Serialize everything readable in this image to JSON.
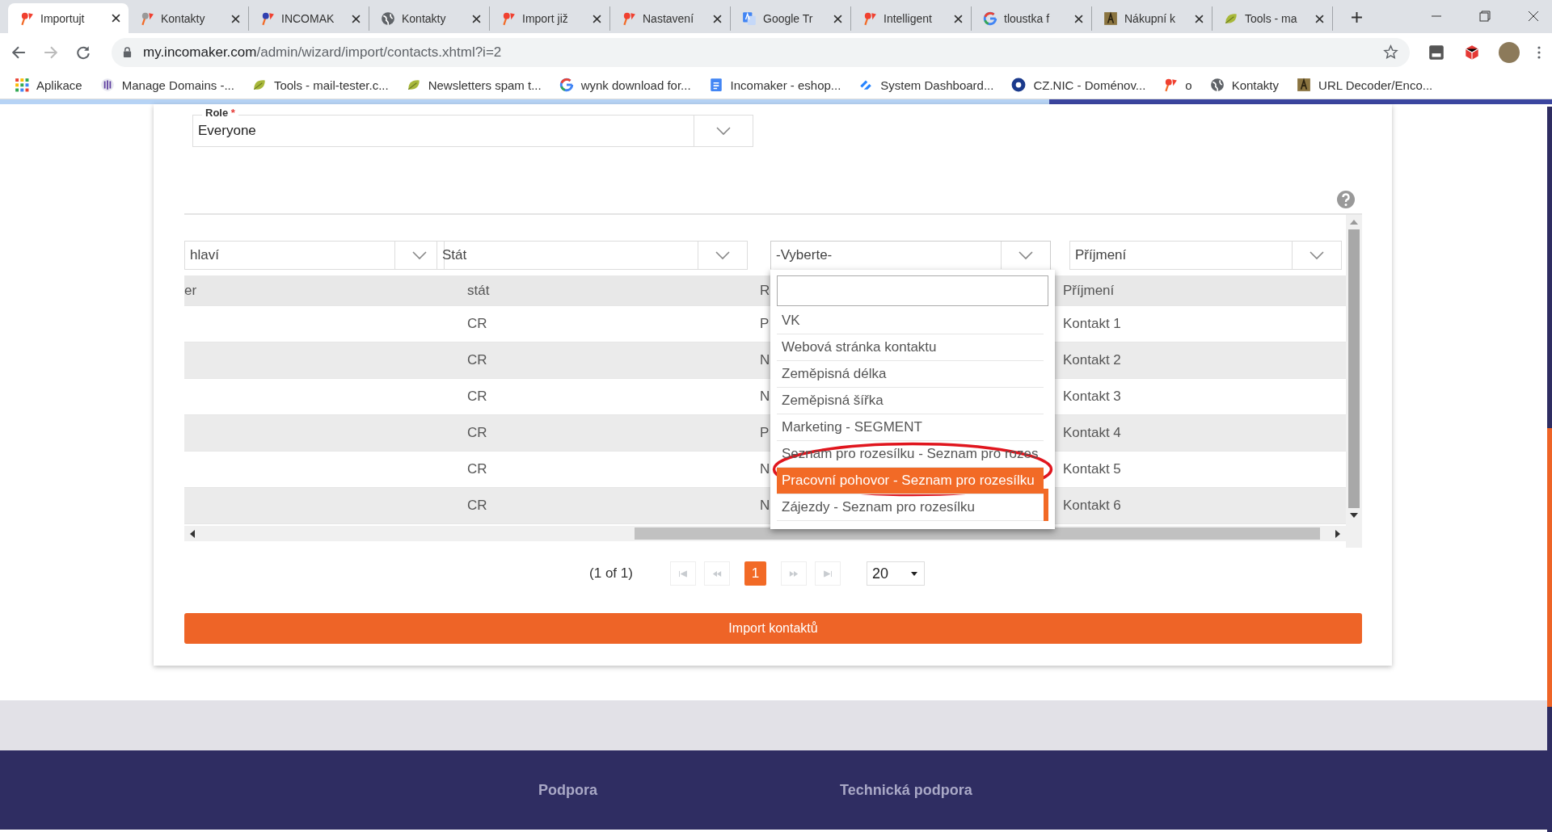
{
  "browser": {
    "tabs": [
      {
        "label": "Importujt",
        "kind": "pin",
        "selected": true
      },
      {
        "label": "Kontakty",
        "kind": "pin-grey",
        "selected": false
      },
      {
        "label": "INCOMAK",
        "kind": "pin-blue",
        "selected": false
      },
      {
        "label": "Kontakty",
        "kind": "globe",
        "selected": false
      },
      {
        "label": "Import již",
        "kind": "pin",
        "selected": false
      },
      {
        "label": "Nastavení",
        "kind": "pin",
        "selected": false
      },
      {
        "label": "Google Tr",
        "kind": "translate",
        "selected": false
      },
      {
        "label": "Intelligent",
        "kind": "pin",
        "selected": false
      },
      {
        "label": "tloustka f",
        "kind": "g",
        "selected": false
      },
      {
        "label": "Nákupní k",
        "kind": "tile",
        "selected": false
      },
      {
        "label": "Tools - ma",
        "kind": "leaf",
        "selected": false
      }
    ],
    "address": {
      "host": "my.incomaker.com",
      "path": "/admin/wizard/import/contacts.xhtml?i=2"
    },
    "bookmarks": [
      {
        "label": "Aplikace",
        "kind": "grid"
      },
      {
        "label": "Manage Domains -...",
        "kind": "domains"
      },
      {
        "label": "Tools - mail-tester.c...",
        "kind": "leaf"
      },
      {
        "label": "Newsletters spam t...",
        "kind": "leaf"
      },
      {
        "label": "wynk download for...",
        "kind": "g"
      },
      {
        "label": "Incomaker - eshop...",
        "kind": "doc"
      },
      {
        "label": "System Dashboard...",
        "kind": "dashboard"
      },
      {
        "label": "CZ.NIC - Doménov...",
        "kind": "circle"
      },
      {
        "label": "o",
        "kind": "pin"
      },
      {
        "label": "Kontakty",
        "kind": "globe"
      },
      {
        "label": "URL Decoder/Enco...",
        "kind": "tile"
      }
    ]
  },
  "form": {
    "role": {
      "label": "Role",
      "required_mark": "*",
      "value": "Everyone"
    }
  },
  "table": {
    "mappings": [
      {
        "value": "hlaví",
        "open": false
      },
      {
        "value": "Stát",
        "open": false
      },
      {
        "value": "-Vyberte-",
        "open": true
      },
      {
        "value": "Příjmení",
        "open": false
      }
    ],
    "columns": [
      "er",
      "stát",
      "R",
      "Příjmení"
    ],
    "rows": [
      [
        "",
        "CR",
        "P",
        "Kontakt 1"
      ],
      [
        "",
        "CR",
        "N",
        "Kontakt 2"
      ],
      [
        "",
        "CR",
        "N",
        "Kontakt 3"
      ],
      [
        "",
        "CR",
        "P",
        "Kontakt 4"
      ],
      [
        "",
        "CR",
        "N",
        "Kontakt 5"
      ],
      [
        "",
        "CR",
        "N",
        "Kontakt 6"
      ]
    ]
  },
  "dropdown": {
    "options": [
      {
        "label": "VK",
        "selected": false
      },
      {
        "label": "Webová stránka kontaktu",
        "selected": false
      },
      {
        "label": "Zeměpisná délka",
        "selected": false
      },
      {
        "label": "Zeměpisná šířka",
        "selected": false
      },
      {
        "label": "Marketing - SEGMENT",
        "selected": false
      },
      {
        "label": "Seznam pro rozesílku - Seznam pro rozes",
        "selected": false
      },
      {
        "label": "Pracovní pohovor - Seznam pro rozesílku",
        "selected": true
      },
      {
        "label": "Zájezdy - Seznam pro rozesílku",
        "selected": false
      }
    ]
  },
  "pagination": {
    "summary": "(1 of 1)",
    "pages": [
      {
        "label": "1",
        "selected": true
      }
    ],
    "page_size": "20"
  },
  "import_button": "Import kontaktů",
  "footer": [
    "Podpora",
    "Technická podpora"
  ]
}
